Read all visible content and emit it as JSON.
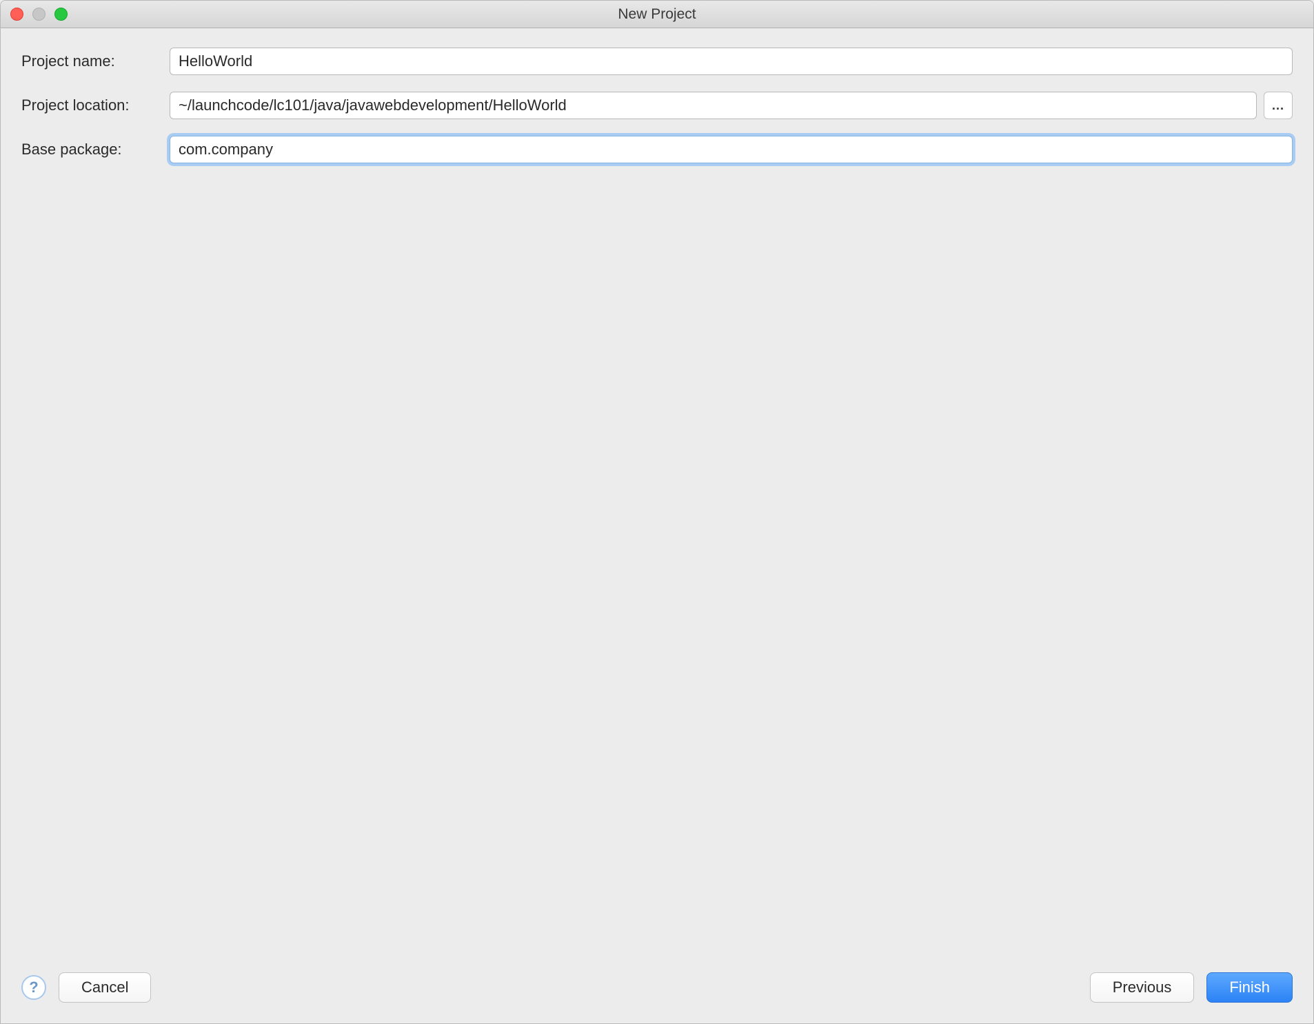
{
  "window": {
    "title": "New Project"
  },
  "form": {
    "project_name": {
      "label": "Project name:",
      "value": "HelloWorld"
    },
    "project_location": {
      "label": "Project location:",
      "value": "~/launchcode/lc101/java/javawebdevelopment/HelloWorld",
      "browse_label": "..."
    },
    "base_package": {
      "label": "Base package:",
      "value": "com.company"
    }
  },
  "footer": {
    "help_label": "?",
    "cancel_label": "Cancel",
    "previous_label": "Previous",
    "finish_label": "Finish"
  }
}
